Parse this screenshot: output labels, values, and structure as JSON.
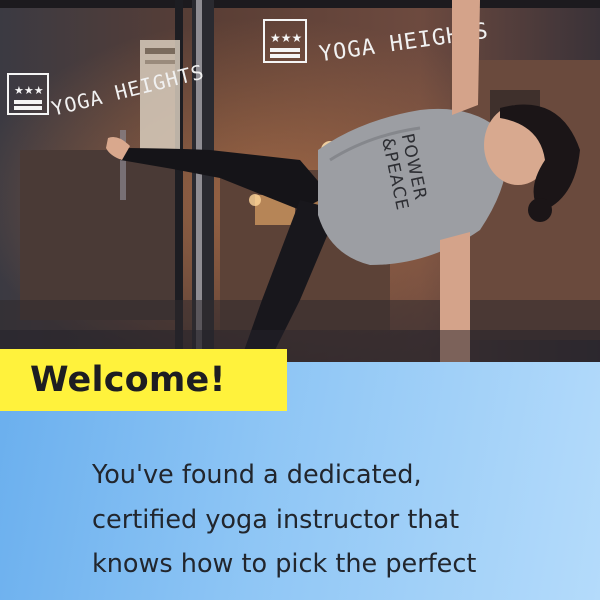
{
  "hero": {
    "window_sign_left": "YOGA HEIGHTS",
    "window_sign_right": "YOGA HEIGHTS",
    "shirt_text": [
      "POWER",
      "&PEACE"
    ]
  },
  "welcome": {
    "title": "Welcome!"
  },
  "intro": {
    "lines": [
      "You've found a dedicated,",
      "certified yoga instructor that",
      "knows how to pick the perfect"
    ]
  },
  "colors": {
    "badge": "#fff23c",
    "panel_start": "#6aafee",
    "panel_end": "#b4dbfb",
    "text": "#22262d"
  }
}
